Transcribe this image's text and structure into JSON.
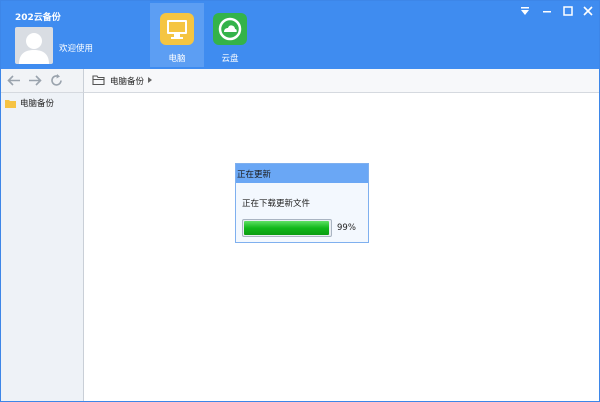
{
  "app": {
    "title": "202云备份",
    "username": "欢迎使用"
  },
  "nav_tabs": [
    {
      "label": "电脑",
      "active": true,
      "icon": "monitor-icon",
      "color": "#f5c542"
    },
    {
      "label": "云盘",
      "active": false,
      "icon": "cloud-icon",
      "color": "#34b34a"
    }
  ],
  "window_controls": [
    "dropdown-icon",
    "minimize-icon",
    "maximize-icon",
    "close-icon"
  ],
  "toolbar": {
    "back": "arrow-left-icon",
    "forward": "arrow-right-icon",
    "refresh": "refresh-icon"
  },
  "sidebar": {
    "items": [
      {
        "label": "电脑备份",
        "icon": "folder-icon"
      }
    ]
  },
  "path_bar": {
    "label": "电脑备份",
    "view_icon": "grid-view-icon"
  },
  "dialog": {
    "title": "正在更新",
    "message": "正在下载更新文件",
    "progress_value": 99,
    "progress_text": "99%"
  },
  "colors": {
    "accent": "#3f8cf0",
    "progress": "#12b81a",
    "dialog_header": "#6aa7f5"
  }
}
